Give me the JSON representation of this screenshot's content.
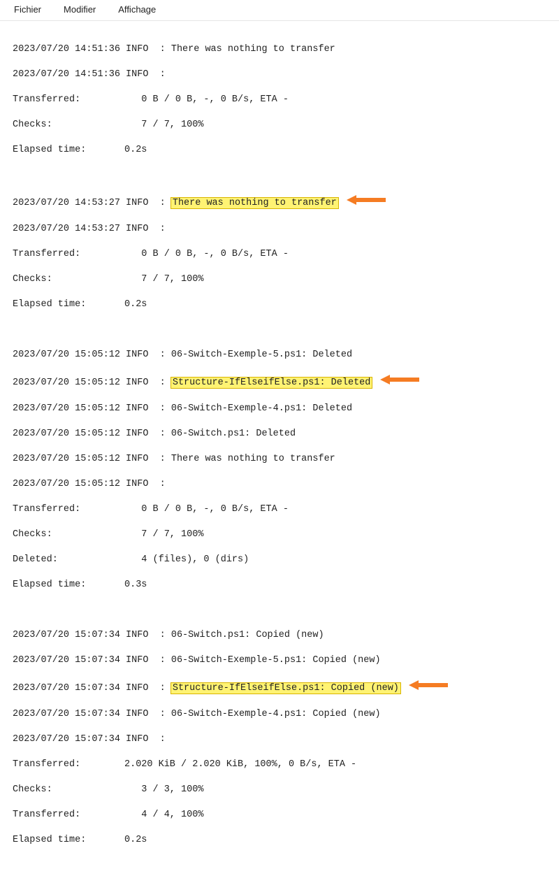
{
  "menu": {
    "file": "Fichier",
    "edit": "Modifier",
    "view": "Affichage"
  },
  "block1": {
    "l1_ts": "2023/07/20 14:51:36 INFO  : ",
    "l1_msg": "There was nothing to transfer",
    "l2_ts": "2023/07/20 14:51:36 INFO  :",
    "transferred_label": "Transferred:",
    "transferred_val": "   0 B / 0 B, -, 0 B/s, ETA -",
    "checks_label": "Checks:",
    "checks_val": "   7 / 7, 100%",
    "elapsed_label": "Elapsed time:",
    "elapsed_val": "0.2s"
  },
  "block2": {
    "l1_ts": "2023/07/20 14:53:27 INFO  : ",
    "l1_hl": "There was nothing to transfer",
    "l2_ts": "2023/07/20 14:53:27 INFO  :",
    "transferred_label": "Transferred:",
    "transferred_val": "   0 B / 0 B, -, 0 B/s, ETA -",
    "checks_label": "Checks:",
    "checks_val": "   7 / 7, 100%",
    "elapsed_label": "Elapsed time:",
    "elapsed_val": "0.2s"
  },
  "block3": {
    "l1": "2023/07/20 15:05:12 INFO  : 06-Switch-Exemple-5.ps1: Deleted",
    "l2_ts": "2023/07/20 15:05:12 INFO  : ",
    "l2_hl": "Structure-IfElseifElse.ps1: Deleted",
    "l3": "2023/07/20 15:05:12 INFO  : 06-Switch-Exemple-4.ps1: Deleted",
    "l4": "2023/07/20 15:05:12 INFO  : 06-Switch.ps1: Deleted",
    "l5": "2023/07/20 15:05:12 INFO  : There was nothing to transfer",
    "l6": "2023/07/20 15:05:12 INFO  :",
    "transferred_label": "Transferred:",
    "transferred_val": "   0 B / 0 B, -, 0 B/s, ETA -",
    "checks_label": "Checks:",
    "checks_val": "   7 / 7, 100%",
    "deleted_label": "Deleted:",
    "deleted_val": "   4 (files), 0 (dirs)",
    "elapsed_label": "Elapsed time:",
    "elapsed_val": "0.3s"
  },
  "block4": {
    "l1": "2023/07/20 15:07:34 INFO  : 06-Switch.ps1: Copied (new)",
    "l2": "2023/07/20 15:07:34 INFO  : 06-Switch-Exemple-5.ps1: Copied (new)",
    "l3_ts": "2023/07/20 15:07:34 INFO  : ",
    "l3_hl": "Structure-IfElseifElse.ps1: Copied (new)",
    "l4": "2023/07/20 15:07:34 INFO  : 06-Switch-Exemple-4.ps1: Copied (new)",
    "l5": "2023/07/20 15:07:34 INFO  :",
    "transferred_label": "Transferred:",
    "transferred_val": "2.020 KiB / 2.020 KiB, 100%, 0 B/s, ETA -",
    "checks_label": "Checks:",
    "checks_val": "   3 / 3, 100%",
    "transferred2_label": "Transferred:",
    "transferred2_val": "   4 / 4, 100%",
    "elapsed_label": "Elapsed time:",
    "elapsed_val": "0.2s"
  },
  "colors": {
    "highlight_bg": "#fff373",
    "highlight_border": "#d8b400",
    "arrow": "#f57c23"
  }
}
